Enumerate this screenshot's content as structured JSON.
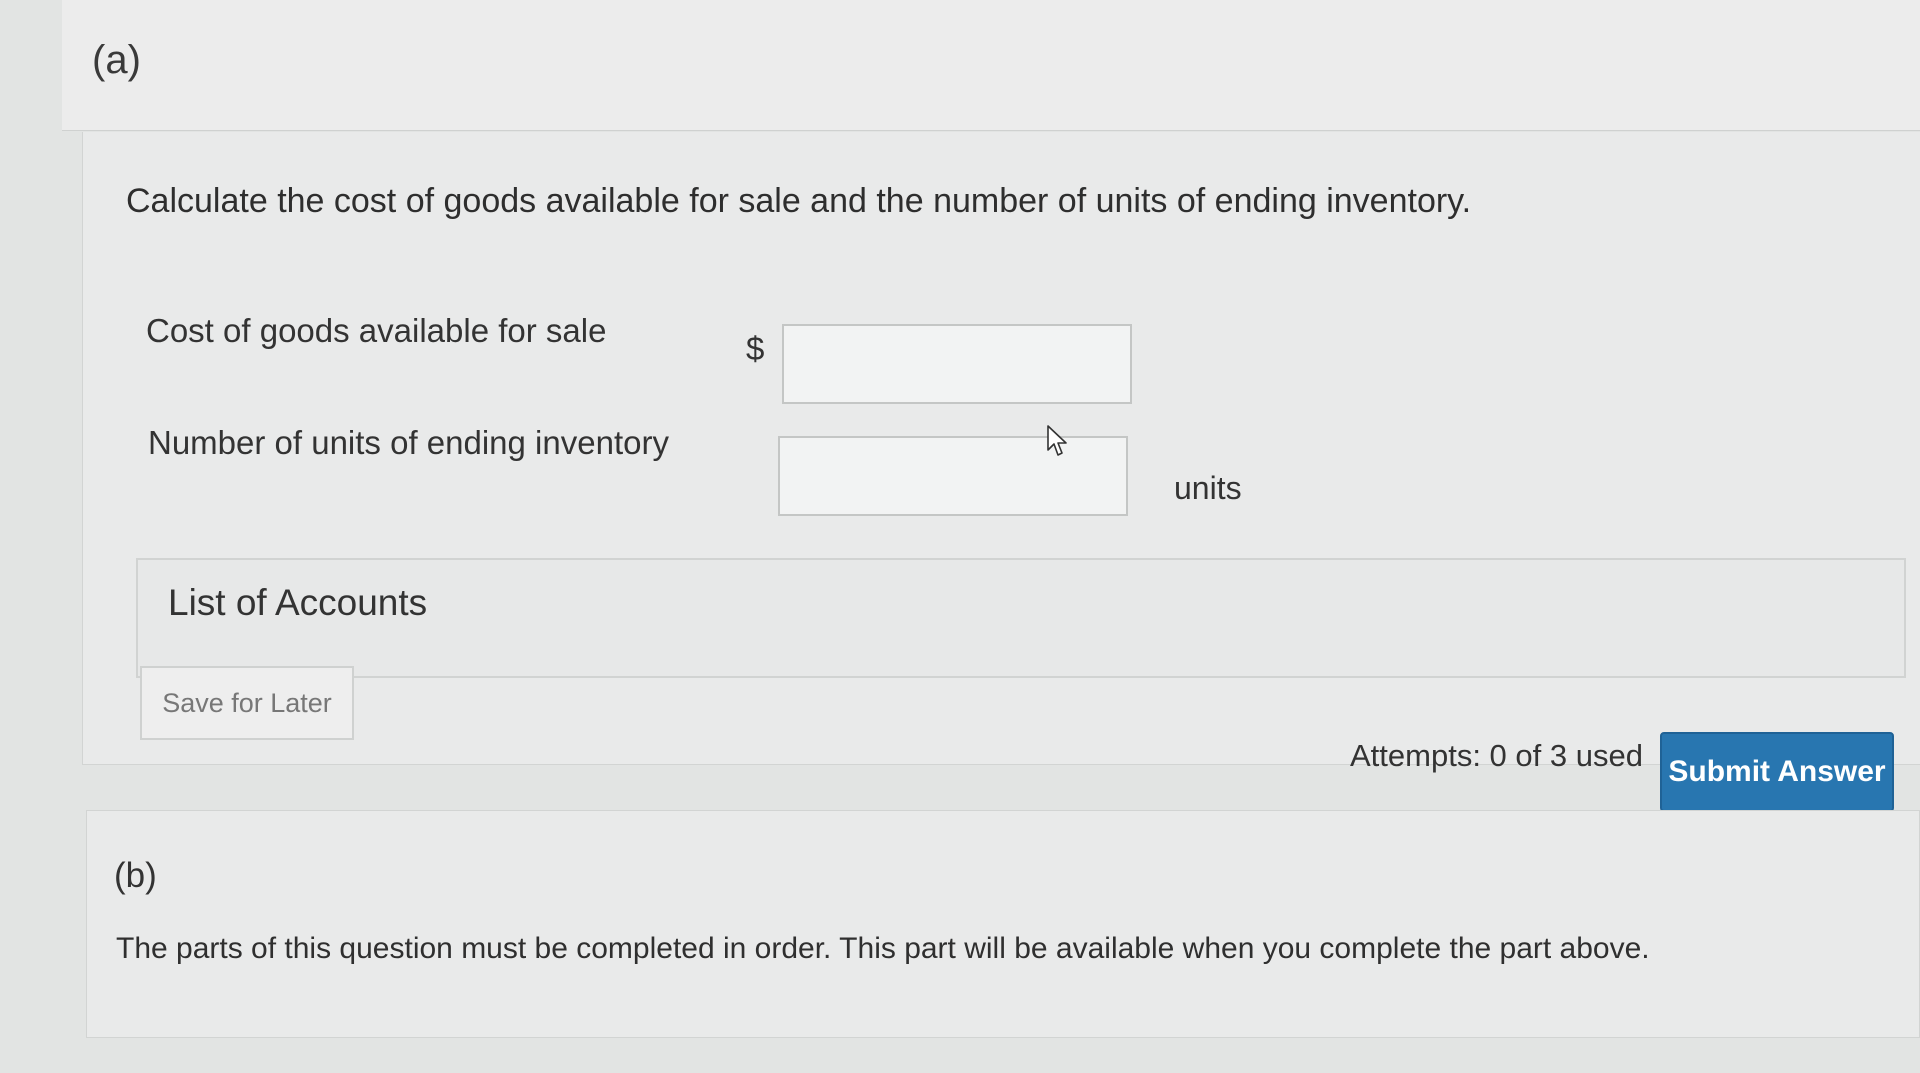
{
  "part_a": {
    "label": "(a)",
    "instruction": "Calculate the cost of goods available for sale and the number of units of ending inventory.",
    "fields": {
      "cogas_label": "Cost of goods available for sale",
      "currency_symbol": "$",
      "cogas_value": "",
      "units_label": "Number of units of ending inventory",
      "units_value": "",
      "units_suffix": "units"
    },
    "list_of_accounts": "List of Accounts",
    "save_for_later": "Save for Later",
    "attempts": "Attempts: 0 of 3 used",
    "submit": "Submit Answer"
  },
  "part_b": {
    "label": "(b)",
    "message": "The parts of this question must be completed in order. This part will be available when you complete the part above."
  },
  "icons": {
    "cursor": "mouse-pointer-icon"
  },
  "colors": {
    "submit_button": "#2876b0",
    "background": "#e2e4e3"
  }
}
